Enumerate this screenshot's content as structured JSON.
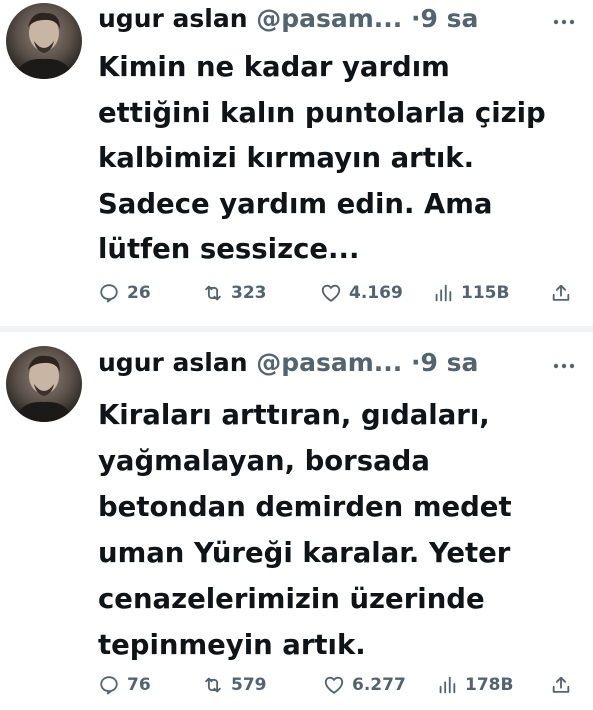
{
  "tweets": [
    {
      "author_name": "ugur aslan",
      "handle": "@pasam...",
      "separator": "·",
      "time": "9 sa",
      "text": "Kimin ne kadar yardım\nettiğini kalın puntolarla çizip\nkalbimizi kırmayın artık.\nSadece yardım edin. Ama\nlütfen sessizce...",
      "replies": "26",
      "retweets": "323",
      "likes": "4.169",
      "views": "115B"
    },
    {
      "author_name": "ugur aslan",
      "handle": "@pasam...",
      "separator": "·",
      "time": "9 sa",
      "text": "Kiraları arttıran, gıdaları,\nyağmalayan, borsada\nbetondan demirden medet\numan Yüreği karalar. Yeter\ncenazelerimizin üzerinde\ntepinmeyin artık.",
      "replies": "76",
      "retweets": "579",
      "likes": "6.277",
      "views": "178B"
    }
  ],
  "icons": {
    "more": "more-horizontal-icon",
    "reply": "reply-bubble-icon",
    "retweet": "retweet-icon",
    "like": "heart-icon",
    "views": "views-bar-icon",
    "share": "share-upload-icon"
  },
  "colors": {
    "text": "#0f1419",
    "secondary": "#536471",
    "divider": "#f2f3f4"
  }
}
